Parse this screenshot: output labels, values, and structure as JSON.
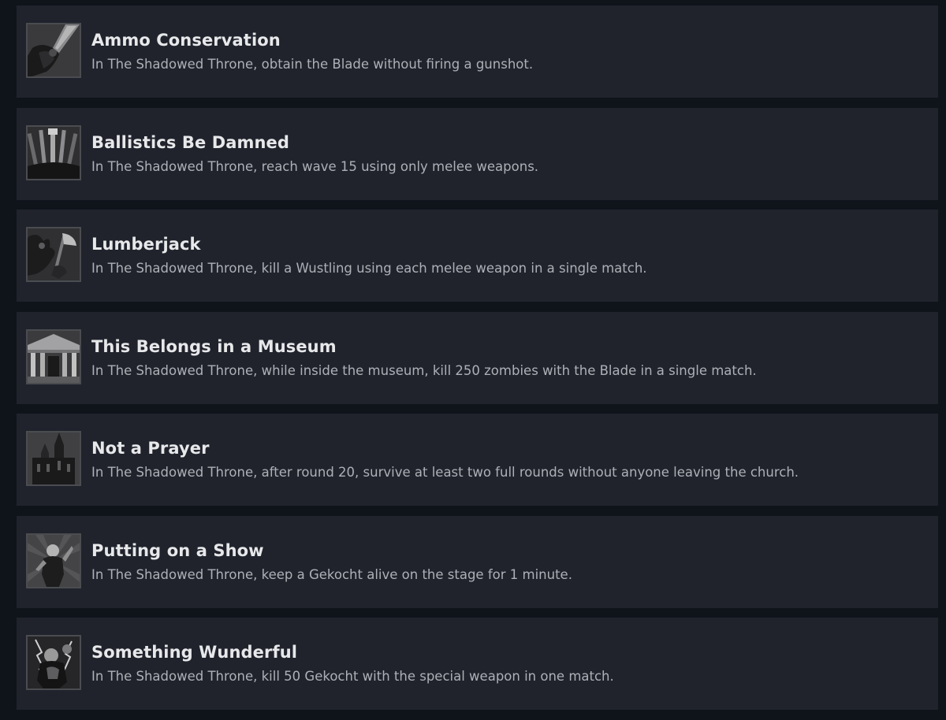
{
  "achievements": [
    {
      "title": "Ammo Conservation",
      "description": "In The Shadowed Throne, obtain the Blade without firing a gunshot.",
      "icon": "blade-arm-icon"
    },
    {
      "title": "Ballistics Be Damned",
      "description": "In The Shadowed Throne, reach wave 15 using only melee weapons.",
      "icon": "melee-weapons-icon"
    },
    {
      "title": "Lumberjack",
      "description": "In The Shadowed Throne, kill a Wustling using each melee weapon in a single match.",
      "icon": "axe-monster-icon"
    },
    {
      "title": "This Belongs in a Museum",
      "description": "In The Shadowed Throne, while inside the museum, kill 250 zombies with the Blade in a single match.",
      "icon": "museum-building-icon"
    },
    {
      "title": "Not a Prayer",
      "description": "In The Shadowed Throne, after round 20, survive at least two full rounds without anyone leaving the church.",
      "icon": "church-icon"
    },
    {
      "title": "Putting on a Show",
      "description": "In The Shadowed Throne, keep a Gekocht alive on the stage for 1 minute.",
      "icon": "gekocht-icon"
    },
    {
      "title": "Something Wunderful",
      "description": "In The Shadowed Throne, kill 50 Gekocht with the special weapon in one match.",
      "icon": "wonder-weapon-icon"
    }
  ]
}
